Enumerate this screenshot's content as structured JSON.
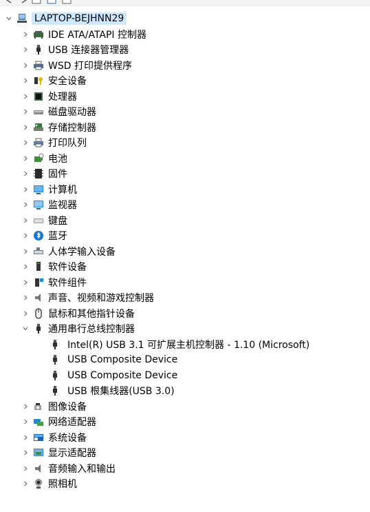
{
  "toolbar": {
    "buttons": [
      "back-arrow-icon",
      "forward-arrow-icon",
      "properties-icon",
      "help-icon",
      "update-driver-icon"
    ]
  },
  "tree": {
    "root": {
      "label": "LAPTOP-BEJHNN29",
      "expanded": true
    },
    "categories": [
      {
        "label": "IDE ATA/ATAPI 控制器",
        "icon": "ide-controller-icon"
      },
      {
        "label": "USB 连接器管理器",
        "icon": "usb-plug-icon"
      },
      {
        "label": "WSD 打印提供程序",
        "icon": "printer-icon"
      },
      {
        "label": "安全设备",
        "icon": "security-device-icon"
      },
      {
        "label": "处理器",
        "icon": "processor-icon"
      },
      {
        "label": "磁盘驱动器",
        "icon": "disk-drive-icon"
      },
      {
        "label": "存储控制器",
        "icon": "storage-controller-icon"
      },
      {
        "label": "打印队列",
        "icon": "print-queue-icon"
      },
      {
        "label": "电池",
        "icon": "battery-icon"
      },
      {
        "label": "固件",
        "icon": "firmware-chip-icon"
      },
      {
        "label": "计算机",
        "icon": "computer-icon"
      },
      {
        "label": "监视器",
        "icon": "monitor-icon"
      },
      {
        "label": "键盘",
        "icon": "keyboard-icon"
      },
      {
        "label": "蓝牙",
        "icon": "bluetooth-icon"
      },
      {
        "label": "人体学输入设备",
        "icon": "hid-icon"
      },
      {
        "label": "软件设备",
        "icon": "software-device-icon"
      },
      {
        "label": "软件组件",
        "icon": "software-component-icon"
      },
      {
        "label": "声音、视频和游戏控制器",
        "icon": "speaker-icon"
      },
      {
        "label": "鼠标和其他指针设备",
        "icon": "mouse-icon"
      },
      {
        "label": "通用串行总线控制器",
        "icon": "usb-plug-icon",
        "expanded": true,
        "children": [
          {
            "label": "Intel(R) USB 3.1 可扩展主机控制器 - 1.10 (Microsoft)",
            "icon": "usb-plug-icon"
          },
          {
            "label": "USB Composite Device",
            "icon": "usb-plug-icon"
          },
          {
            "label": "USB Composite Device",
            "icon": "usb-plug-icon"
          },
          {
            "label": "USB 根集线器(USB 3.0)",
            "icon": "usb-plug-icon"
          }
        ]
      },
      {
        "label": "图像设备",
        "icon": "camera-device-icon"
      },
      {
        "label": "网络适配器",
        "icon": "network-adapter-icon"
      },
      {
        "label": "系统设备",
        "icon": "system-device-icon"
      },
      {
        "label": "显示适配器",
        "icon": "display-adapter-icon"
      },
      {
        "label": "音频输入和输出",
        "icon": "audio-io-icon"
      },
      {
        "label": "照相机",
        "icon": "webcam-icon"
      }
    ]
  }
}
